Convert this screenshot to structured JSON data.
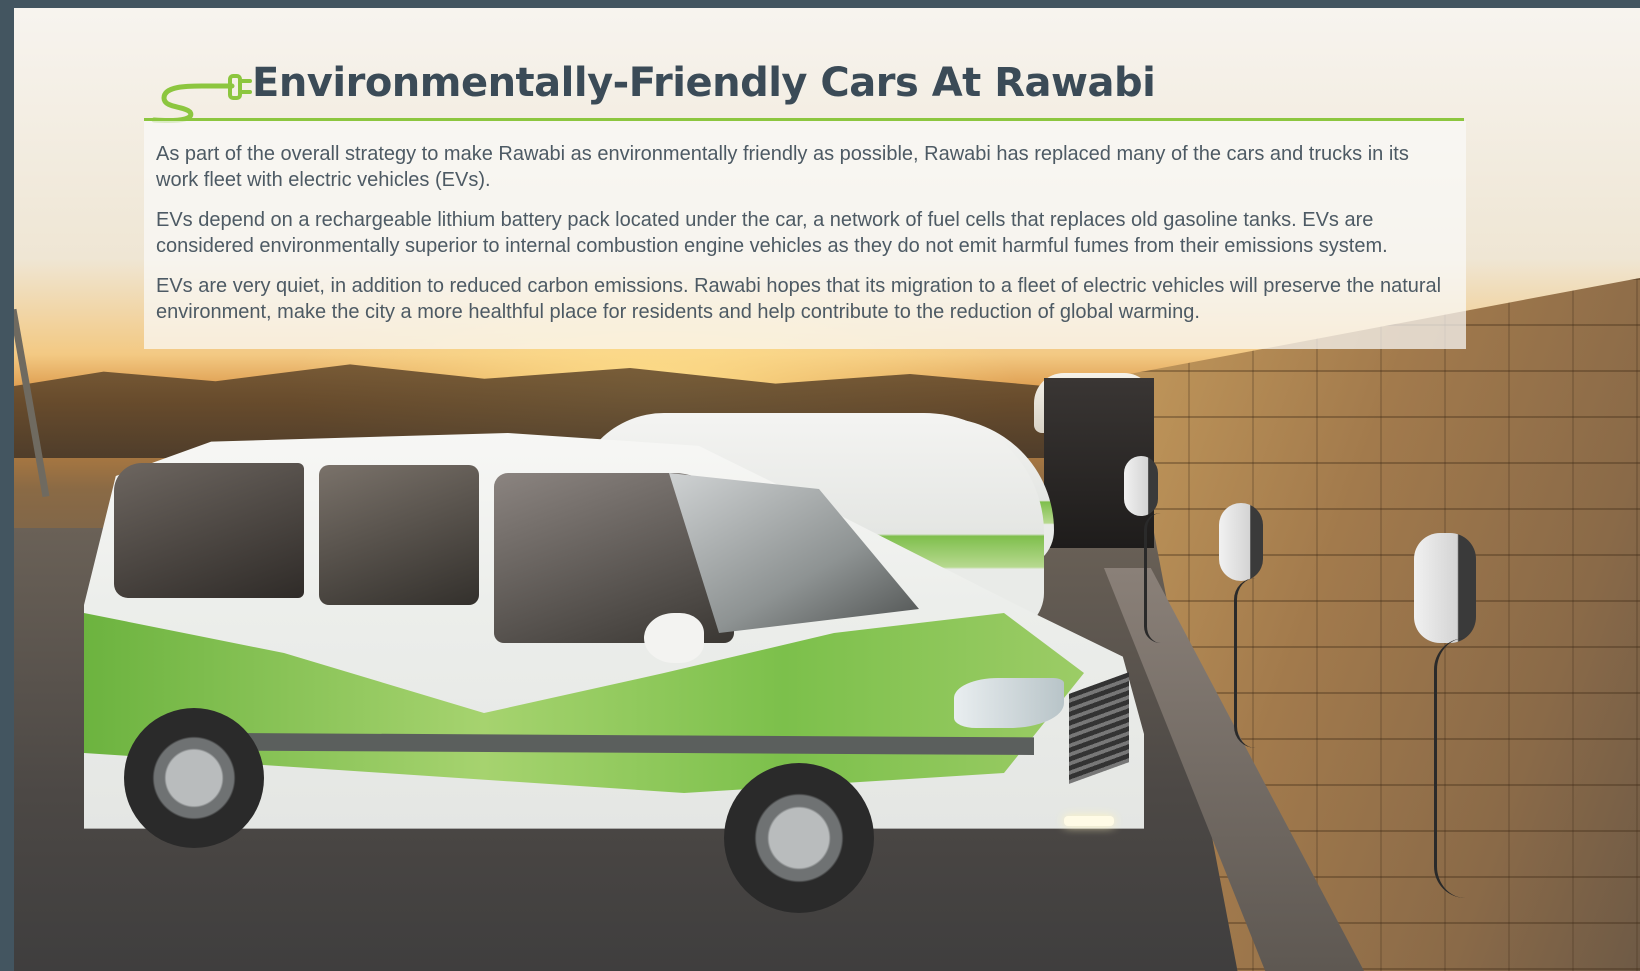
{
  "heading": "Environmentally-Friendly Cars At Rawabi",
  "paragraphs": [
    "As part of the overall strategy to make Rawabi as environmentally friendly as possible, Rawabi has replaced many of the cars and trucks in its work fleet with electric vehicles (EVs).",
    "EVs depend on a rechargeable lithium battery pack located under the car, a network of fuel cells that replaces old gasoline tanks. EVs are considered environmentally superior to internal combustion engine vehicles as they do not emit harmful fumes from their emissions system.",
    "EVs are very quiet, in addition to reduced carbon emissions.  Rawabi hopes that its migration to a fleet of electric vehicles will preserve the natural environment, make the city a more healthful place for residents and help contribute to the reduction of global warming."
  ],
  "colors": {
    "accent_green": "#8cc63f",
    "heading": "#3b4b57",
    "body_text": "#4d5a64",
    "frame": "#435560"
  },
  "icons": {
    "heading_icon": "electric-plug-icon"
  }
}
